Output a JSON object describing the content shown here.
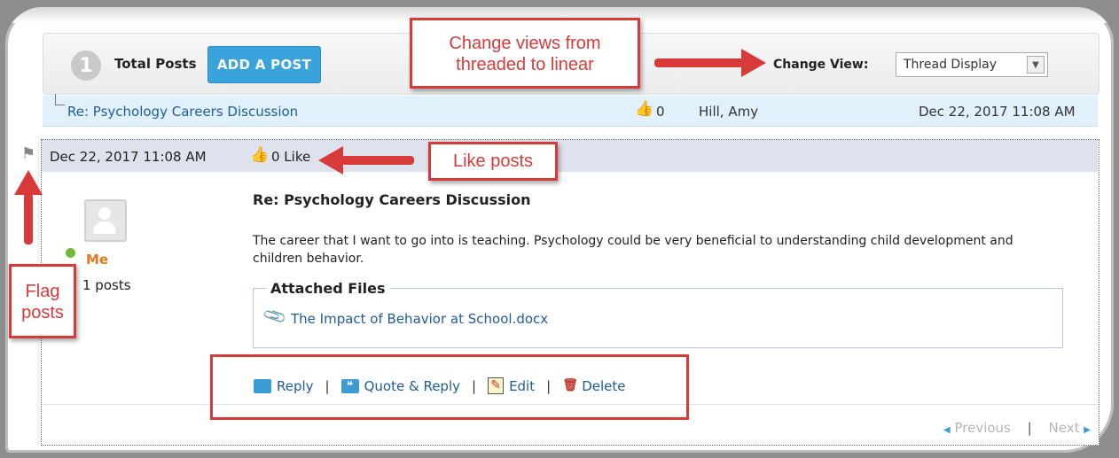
{
  "toolbar": {
    "post_count": "1",
    "total_posts_label": "Total Posts",
    "add_post_label": "ADD A POST",
    "change_view_label": "Change View:",
    "view_selected": "Thread Display"
  },
  "thread_row": {
    "title": "Re: Psychology Careers Discussion",
    "likes": "0",
    "author": "Hill, Amy",
    "date": "Dec 22, 2017 11:08 AM"
  },
  "post": {
    "date": "Dec 22, 2017 11:08 AM",
    "like_text": "0 Like",
    "author_name": "Me",
    "author_posts": "1 posts",
    "subject": "Re: Psychology Careers Discussion",
    "body": "The career that I want to go into is teaching.  Psychology could be very beneficial to understanding child development and children behavior.",
    "attached_files_label": "Attached Files",
    "attachment": "The Impact of Behavior at School.docx",
    "actions": {
      "reply": "Reply",
      "quote_reply": "Quote & Reply",
      "edit": "Edit",
      "delete": "Delete",
      "separator": "|"
    }
  },
  "pager": {
    "previous": "Previous",
    "separator": "|",
    "next": "Next"
  },
  "annotations": {
    "change_views": "Change views from threaded to linear",
    "like_posts": "Like posts",
    "flag_posts": "Flag posts"
  },
  "colors": {
    "accent_red": "#d83a3a",
    "link_blue": "#1f5b99",
    "button_blue": "#3aa3dc",
    "author_orange": "#e07a1f",
    "online_green": "#6cbb3c"
  },
  "icons": [
    "flag-icon",
    "thumbs-up-icon",
    "avatar-icon",
    "paperclip-icon",
    "reply-icon",
    "quote-icon",
    "edit-icon",
    "delete-icon"
  ]
}
